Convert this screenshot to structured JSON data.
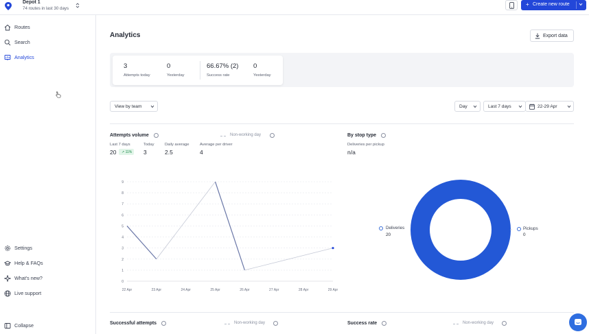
{
  "topbar": {
    "depot_name": "Depot 1",
    "depot_sub": "74 routes in last 30 days",
    "create_label": "Create new route"
  },
  "sidebar": {
    "nav": [
      {
        "label": "Routes",
        "icon": "home-icon"
      },
      {
        "label": "Search",
        "icon": "search-icon"
      },
      {
        "label": "Analytics",
        "icon": "analytics-icon",
        "active": true
      }
    ],
    "footer": [
      {
        "label": "Settings",
        "icon": "gear-icon"
      },
      {
        "label": "Help & FAQs",
        "icon": "help-icon"
      },
      {
        "label": "What's new?",
        "icon": "sparkle-icon"
      },
      {
        "label": "Live support",
        "icon": "globe-icon"
      }
    ],
    "collapse_label": "Collapse"
  },
  "main": {
    "title": "Analytics",
    "export_label": "Export data",
    "stats": [
      {
        "value": "3",
        "label": "Attempts today"
      },
      {
        "value": "0",
        "label": "Yesterday"
      },
      {
        "value": "66.67% (2)",
        "label": "Success rate"
      },
      {
        "value": "0",
        "label": "Yesterday"
      }
    ],
    "view_by": "View by team",
    "granularity": "Day",
    "range": "Last 7 days",
    "dates": "22-29 Apr"
  },
  "attempts": {
    "title": "Attempts volume",
    "non_working": "Non-working day",
    "kpis": [
      {
        "label": "Last 7 days",
        "value": "20"
      },
      {
        "label": "Today",
        "value": "3"
      },
      {
        "label": "Daily average",
        "value": "2.5"
      },
      {
        "label": "Average per driver",
        "value": "4"
      }
    ],
    "badge": "↗ 11%"
  },
  "stop_type": {
    "title": "By stop type",
    "sub_label": "Deliveries per pickup",
    "sub_value": "n/a",
    "legend": [
      {
        "name": "Deliveries",
        "value": "20"
      },
      {
        "name": "Pickups",
        "value": "0"
      }
    ]
  },
  "bottom": {
    "successful_title": "Successful attempts",
    "non_working": "Non-working day",
    "rate_title": "Success rate",
    "non_working2": "Non-working day"
  },
  "colors": {
    "accent": "#2347d9",
    "donut": "#2358d6",
    "line": "#6b78a8"
  },
  "chart_data": [
    {
      "type": "line",
      "title": "Attempts volume",
      "categories": [
        "22 Apr",
        "23 Apr",
        "24 Apr",
        "25 Apr",
        "26 Apr",
        "27 Apr",
        "28 Apr",
        "29 Apr"
      ],
      "y_ticks": [
        "0",
        "1",
        "2",
        "3",
        "4",
        "5",
        "6",
        "7",
        "8",
        "9"
      ],
      "ylim": [
        0,
        9
      ],
      "series": [
        {
          "values": [
            5,
            2,
            null,
            9,
            1,
            null,
            null,
            3
          ]
        }
      ],
      "non_working_dashed": [
        [
          2,
          3
        ],
        [
          4,
          7
        ]
      ],
      "grid": true
    },
    {
      "type": "pie",
      "title": "By stop type",
      "categories": [
        "Deliveries",
        "Pickups"
      ],
      "values": [
        20,
        0
      ],
      "donut": true
    }
  ]
}
